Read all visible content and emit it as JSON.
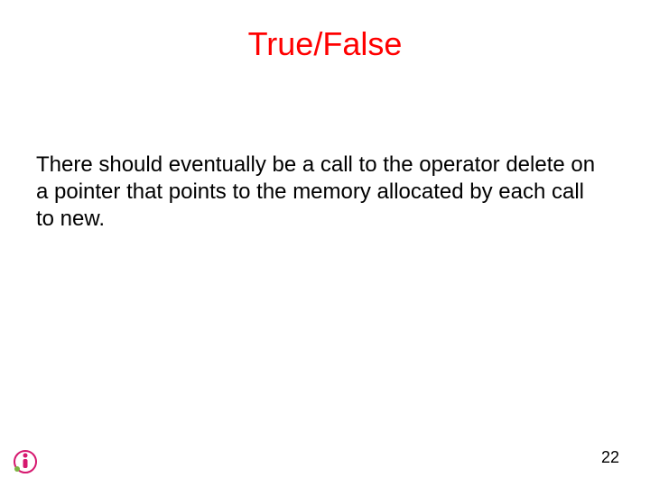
{
  "slide": {
    "title": "True/False",
    "body": "There should eventually be a call to the operator delete on a pointer that points to the memory allocated by each call to new.",
    "page_number": "22"
  }
}
